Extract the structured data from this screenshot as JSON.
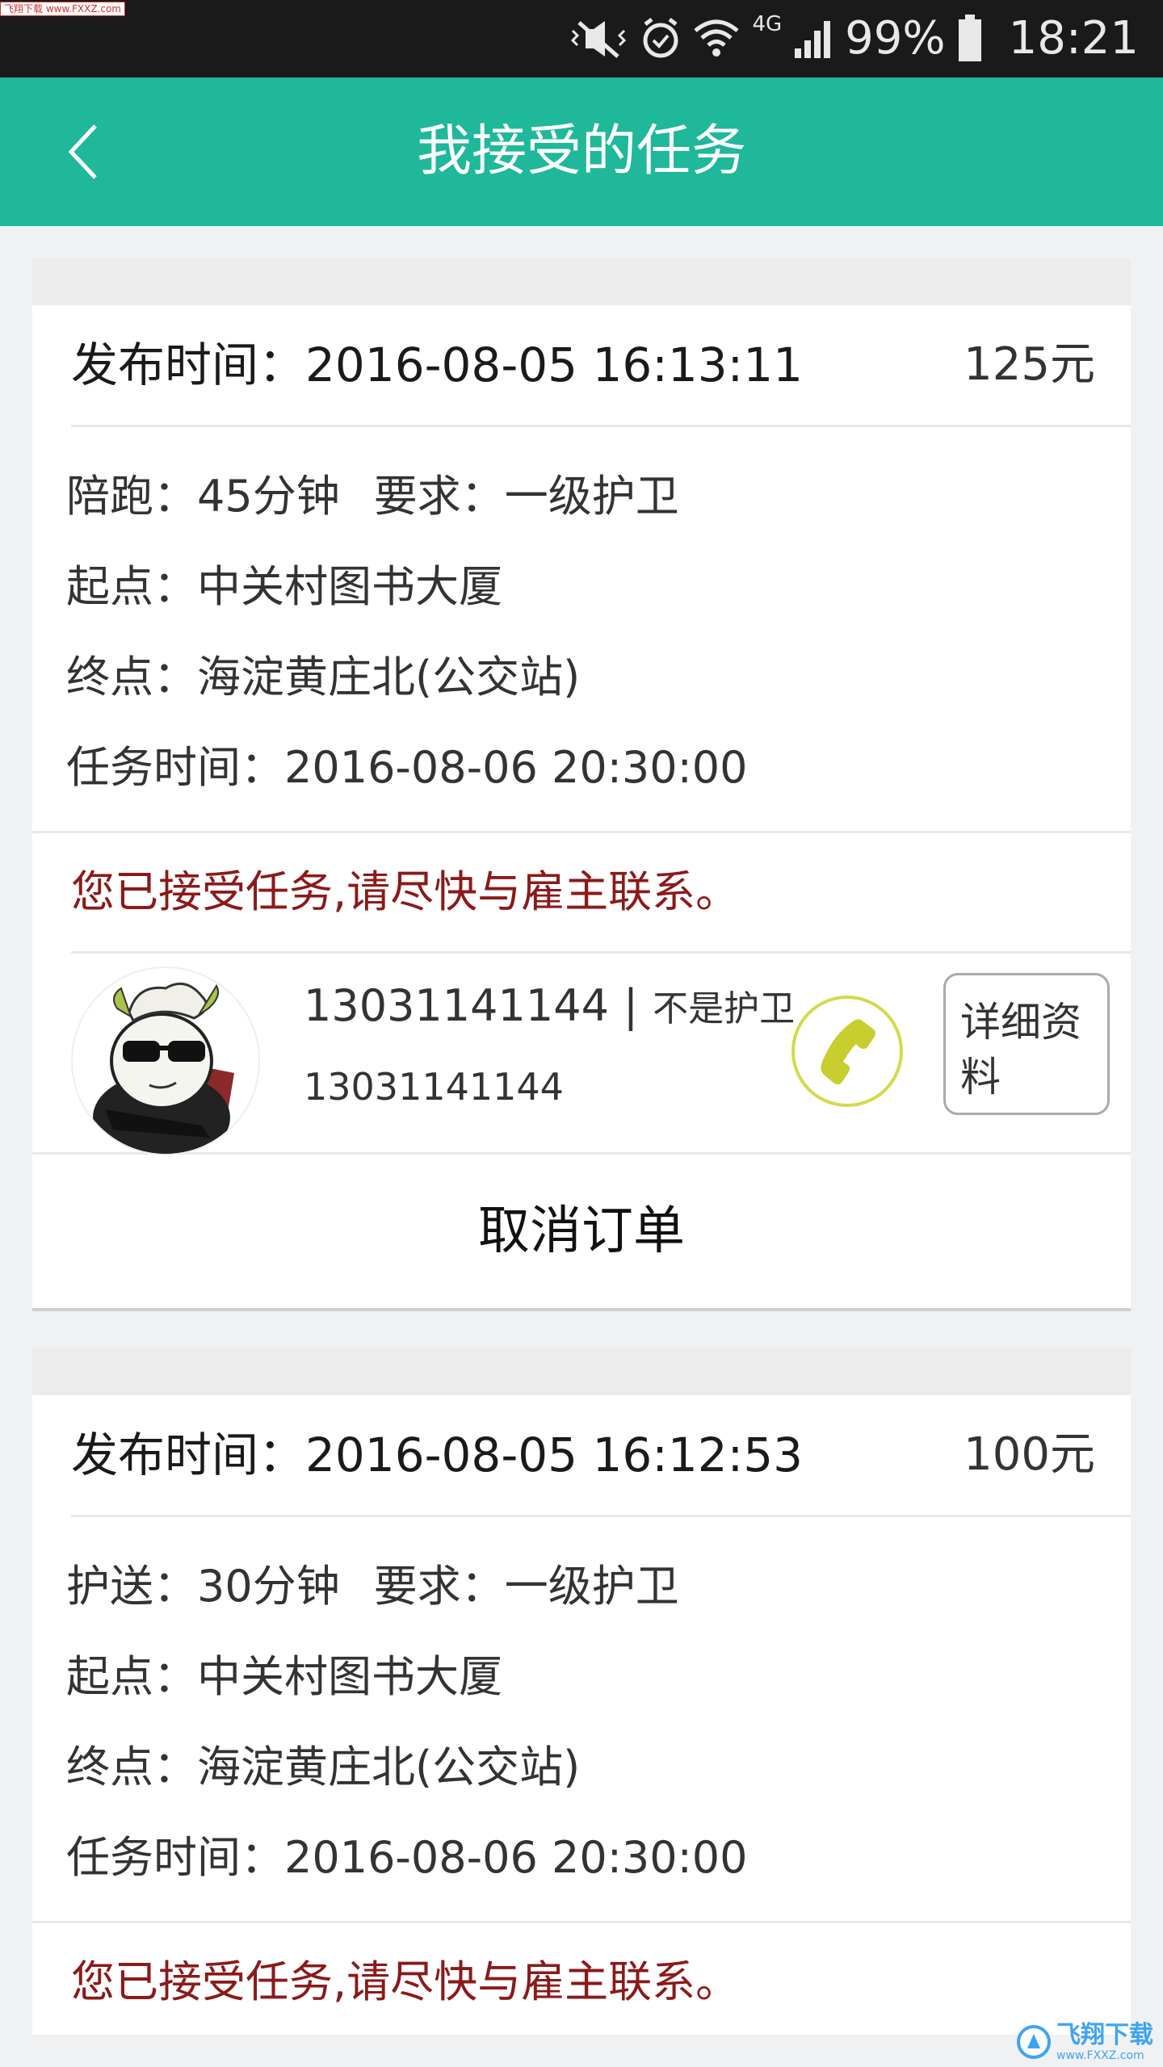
{
  "status_bar": {
    "watermark": "飞翔下载 www.FXXZ.com",
    "network": "4G",
    "battery": "99%",
    "time": "18:21",
    "icons": [
      "mute-vibrate-icon",
      "alarm-icon",
      "wifi-icon",
      "signal-icon",
      "battery-icon"
    ]
  },
  "header": {
    "title": "我接受的任务"
  },
  "tasks": [
    {
      "publish": "发布时间：2016-08-05 16:13:11",
      "price": "125元",
      "duration": "陪跑：45分钟",
      "requirement": "要求：一级护卫",
      "start": "起点：中关村图书大厦",
      "end": "终点：海淀黄庄北(公交站)",
      "task_time": "任务时间：2016-08-06 20:30:00",
      "notice": "您已接受任务,请尽快与雇主联系。",
      "employer": {
        "phone": "13031141144",
        "separator": "|",
        "role": "不是护卫",
        "phone2": "13031141144",
        "details_label": "详细资料"
      },
      "cancel_label": "取消订单"
    },
    {
      "publish": "发布时间：2016-08-05 16:12:53",
      "price": "100元",
      "duration": "护送：30分钟",
      "requirement": "要求：一级护卫",
      "start": "起点：中关村图书大厦",
      "end": "终点：海淀黄庄北(公交站)",
      "task_time": "任务时间：2016-08-06 20:30:00",
      "notice": "您已接受任务,请尽快与雇主联系。"
    }
  ],
  "bottom_watermark": {
    "title": "飞翔下载",
    "url": "www.FXXZ.com"
  },
  "colors": {
    "accent": "#1fb89a",
    "notice": "#8b1a1a",
    "call": "#c8ce2e"
  }
}
